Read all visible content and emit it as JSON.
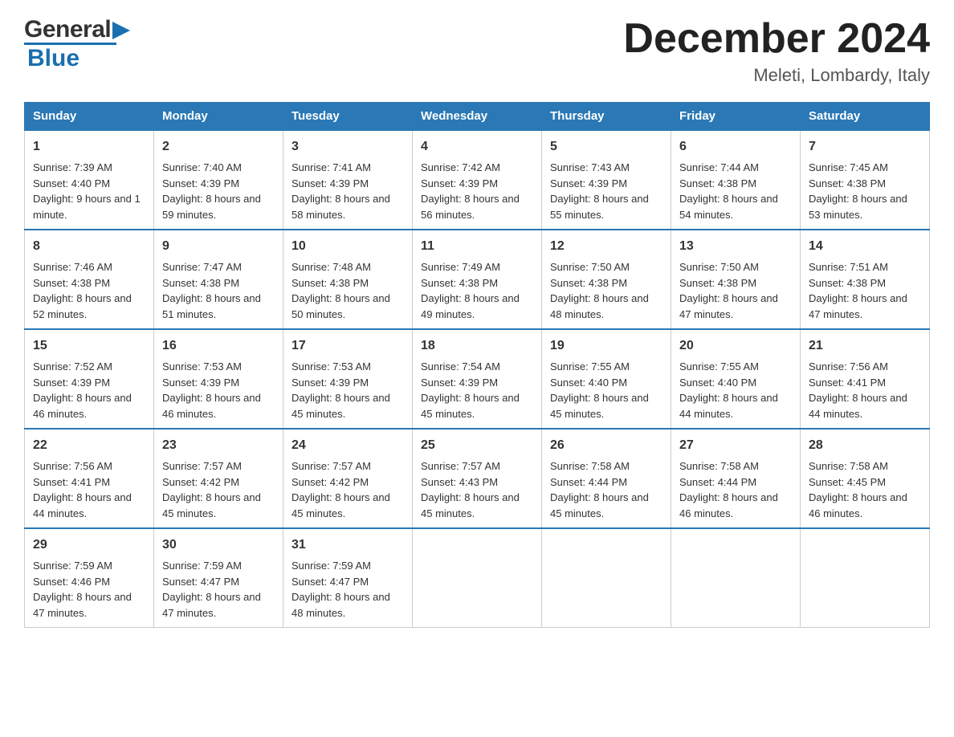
{
  "header": {
    "logo_general": "General",
    "logo_blue": "Blue",
    "month_title": "December 2024",
    "location": "Meleti, Lombardy, Italy"
  },
  "days_of_week": [
    "Sunday",
    "Monday",
    "Tuesday",
    "Wednesday",
    "Thursday",
    "Friday",
    "Saturday"
  ],
  "weeks": [
    [
      {
        "day": "1",
        "sunrise": "7:39 AM",
        "sunset": "4:40 PM",
        "daylight": "9 hours and 1 minute."
      },
      {
        "day": "2",
        "sunrise": "7:40 AM",
        "sunset": "4:39 PM",
        "daylight": "8 hours and 59 minutes."
      },
      {
        "day": "3",
        "sunrise": "7:41 AM",
        "sunset": "4:39 PM",
        "daylight": "8 hours and 58 minutes."
      },
      {
        "day": "4",
        "sunrise": "7:42 AM",
        "sunset": "4:39 PM",
        "daylight": "8 hours and 56 minutes."
      },
      {
        "day": "5",
        "sunrise": "7:43 AM",
        "sunset": "4:39 PM",
        "daylight": "8 hours and 55 minutes."
      },
      {
        "day": "6",
        "sunrise": "7:44 AM",
        "sunset": "4:38 PM",
        "daylight": "8 hours and 54 minutes."
      },
      {
        "day": "7",
        "sunrise": "7:45 AM",
        "sunset": "4:38 PM",
        "daylight": "8 hours and 53 minutes."
      }
    ],
    [
      {
        "day": "8",
        "sunrise": "7:46 AM",
        "sunset": "4:38 PM",
        "daylight": "8 hours and 52 minutes."
      },
      {
        "day": "9",
        "sunrise": "7:47 AM",
        "sunset": "4:38 PM",
        "daylight": "8 hours and 51 minutes."
      },
      {
        "day": "10",
        "sunrise": "7:48 AM",
        "sunset": "4:38 PM",
        "daylight": "8 hours and 50 minutes."
      },
      {
        "day": "11",
        "sunrise": "7:49 AM",
        "sunset": "4:38 PM",
        "daylight": "8 hours and 49 minutes."
      },
      {
        "day": "12",
        "sunrise": "7:50 AM",
        "sunset": "4:38 PM",
        "daylight": "8 hours and 48 minutes."
      },
      {
        "day": "13",
        "sunrise": "7:50 AM",
        "sunset": "4:38 PM",
        "daylight": "8 hours and 47 minutes."
      },
      {
        "day": "14",
        "sunrise": "7:51 AM",
        "sunset": "4:38 PM",
        "daylight": "8 hours and 47 minutes."
      }
    ],
    [
      {
        "day": "15",
        "sunrise": "7:52 AM",
        "sunset": "4:39 PM",
        "daylight": "8 hours and 46 minutes."
      },
      {
        "day": "16",
        "sunrise": "7:53 AM",
        "sunset": "4:39 PM",
        "daylight": "8 hours and 46 minutes."
      },
      {
        "day": "17",
        "sunrise": "7:53 AM",
        "sunset": "4:39 PM",
        "daylight": "8 hours and 45 minutes."
      },
      {
        "day": "18",
        "sunrise": "7:54 AM",
        "sunset": "4:39 PM",
        "daylight": "8 hours and 45 minutes."
      },
      {
        "day": "19",
        "sunrise": "7:55 AM",
        "sunset": "4:40 PM",
        "daylight": "8 hours and 45 minutes."
      },
      {
        "day": "20",
        "sunrise": "7:55 AM",
        "sunset": "4:40 PM",
        "daylight": "8 hours and 44 minutes."
      },
      {
        "day": "21",
        "sunrise": "7:56 AM",
        "sunset": "4:41 PM",
        "daylight": "8 hours and 44 minutes."
      }
    ],
    [
      {
        "day": "22",
        "sunrise": "7:56 AM",
        "sunset": "4:41 PM",
        "daylight": "8 hours and 44 minutes."
      },
      {
        "day": "23",
        "sunrise": "7:57 AM",
        "sunset": "4:42 PM",
        "daylight": "8 hours and 45 minutes."
      },
      {
        "day": "24",
        "sunrise": "7:57 AM",
        "sunset": "4:42 PM",
        "daylight": "8 hours and 45 minutes."
      },
      {
        "day": "25",
        "sunrise": "7:57 AM",
        "sunset": "4:43 PM",
        "daylight": "8 hours and 45 minutes."
      },
      {
        "day": "26",
        "sunrise": "7:58 AM",
        "sunset": "4:44 PM",
        "daylight": "8 hours and 45 minutes."
      },
      {
        "day": "27",
        "sunrise": "7:58 AM",
        "sunset": "4:44 PM",
        "daylight": "8 hours and 46 minutes."
      },
      {
        "day": "28",
        "sunrise": "7:58 AM",
        "sunset": "4:45 PM",
        "daylight": "8 hours and 46 minutes."
      }
    ],
    [
      {
        "day": "29",
        "sunrise": "7:59 AM",
        "sunset": "4:46 PM",
        "daylight": "8 hours and 47 minutes."
      },
      {
        "day": "30",
        "sunrise": "7:59 AM",
        "sunset": "4:47 PM",
        "daylight": "8 hours and 47 minutes."
      },
      {
        "day": "31",
        "sunrise": "7:59 AM",
        "sunset": "4:47 PM",
        "daylight": "8 hours and 48 minutes."
      },
      null,
      null,
      null,
      null
    ]
  ],
  "labels": {
    "sunrise": "Sunrise:",
    "sunset": "Sunset:",
    "daylight": "Daylight:"
  }
}
